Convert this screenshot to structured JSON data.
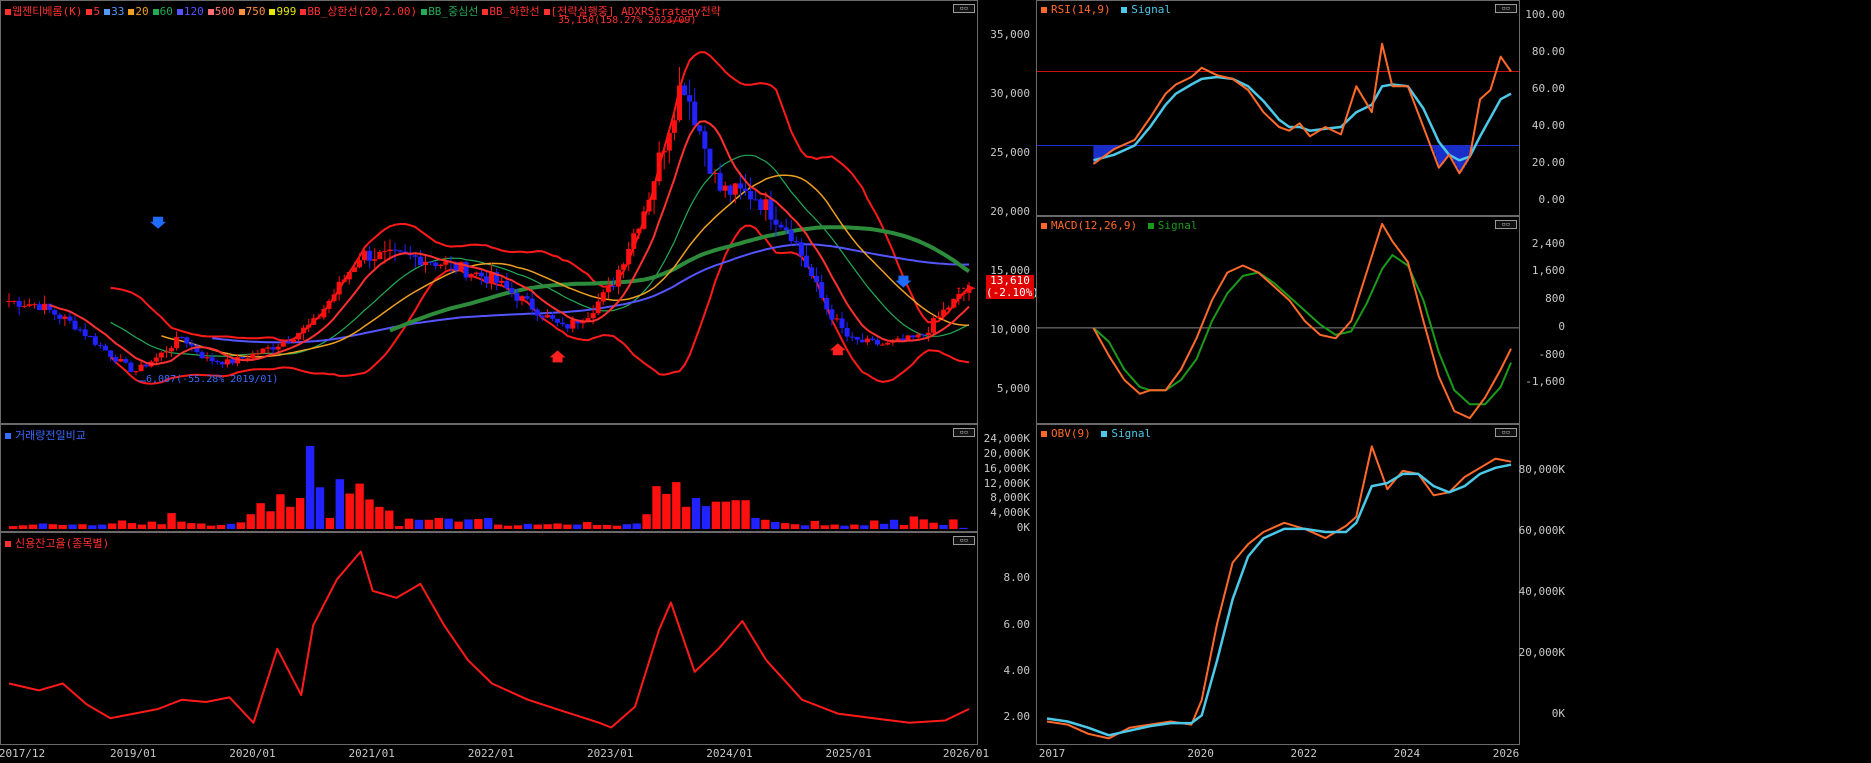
{
  "colors": {
    "up": "#ff1010",
    "down": "#2222ff",
    "bb": "#ff1a1a",
    "ma5": "#ff3030",
    "ma20": "#f0a020",
    "ma60": "#22aa55",
    "ma120": "#5555ff",
    "ma500": "#2d8c3c",
    "rsi": "#ff6a2a",
    "rsiSig": "#4cc8e8",
    "macd": "#ff6a2a",
    "macdSig": "#1a9a1a",
    "obv": "#ff6a2a",
    "obvSig": "#4cc8e8",
    "grid": "#555555"
  },
  "price_panel": {
    "legend": [
      {
        "text": "웹젠티베롬(K)",
        "color": "#ff3030"
      },
      {
        "text": "5",
        "color": "#ff3030"
      },
      {
        "text": "33",
        "color": "#5599ff"
      },
      {
        "text": "20",
        "color": "#f0a020"
      },
      {
        "text": "60",
        "color": "#22aa55"
      },
      {
        "text": "120",
        "color": "#5555ff"
      },
      {
        "text": "500",
        "color": "#ff7070"
      },
      {
        "text": "750",
        "color": "#ff9040"
      },
      {
        "text": "999",
        "color": "#e6e600"
      },
      {
        "text": "BB_상한선(20,2.00)",
        "color": "#ff3030"
      },
      {
        "text": "BB_중심선",
        "color": "#22aa55"
      },
      {
        "text": "BB_하한선",
        "color": "#ff3030"
      },
      {
        "text": "[전략실행중] ADXRStrategy전략",
        "color": "#ff3030"
      }
    ],
    "high_annotation": "35,150(158.27% 2023/09)",
    "low_annotation": "6,087(-55.28% 2019/01)",
    "current_price": "13,610",
    "current_change": "(-2.10%)"
  },
  "volume_panel": {
    "legend": "거래량전일비교",
    "legend_color": "#3a6aff"
  },
  "credit_panel": {
    "legend": "신용잔고율(종목별)",
    "legend_color": "#ff3030"
  },
  "rsi_panel": {
    "legend_a": "RSI(14,9)",
    "legend_b": "Signal"
  },
  "macd_panel": {
    "legend_a": "MACD(12,26,9)",
    "legend_b": "Signal"
  },
  "obv_panel": {
    "legend_a": "OBV(9)",
    "legend_b": "Signal"
  },
  "axes": {
    "price_ticks": [
      "35,000",
      "30,000",
      "25,000",
      "20,000",
      "15,000",
      "10,000",
      "5,000"
    ],
    "volume_ticks": [
      "24,000K",
      "20,000K",
      "16,000K",
      "12,000K",
      "8,000K",
      "4,000K",
      "0K"
    ],
    "credit_ticks": [
      "8.00",
      "6.00",
      "4.00",
      "2.00"
    ],
    "rsi_ticks": [
      "100.00",
      "80.00",
      "60.00",
      "40.00",
      "20.00",
      "0.00"
    ],
    "macd_ticks": [
      "2,400",
      "1,600",
      "800",
      "0",
      "-800",
      "-1,600"
    ],
    "obv_ticks": [
      "80,000K",
      "60,000K",
      "40,000K",
      "20,000K",
      "0K"
    ],
    "left_x_labels": [
      "2017/12",
      "2019/01",
      "2020/01",
      "2021/01",
      "2022/01",
      "2023/01",
      "2024/01",
      "2025/01",
      "2026/01"
    ],
    "right_x_labels": [
      "2017",
      "2020",
      "2022",
      "2024",
      "2026"
    ]
  },
  "chart_data": [
    {
      "type": "candlestick",
      "title": "웹젠티베롬(K)",
      "x_range": [
        "2017/12",
        "2026/01"
      ],
      "ylim": [
        2000,
        38000
      ],
      "close_trend": [
        [
          2017.9,
          12600
        ],
        [
          2018.2,
          12200
        ],
        [
          2018.5,
          10500
        ],
        [
          2018.8,
          8000
        ],
        [
          2019.0,
          6500
        ],
        [
          2019.2,
          7800
        ],
        [
          2019.4,
          9500
        ],
        [
          2019.6,
          7600
        ],
        [
          2019.8,
          7300
        ],
        [
          2020.0,
          8000
        ],
        [
          2020.2,
          8800
        ],
        [
          2020.5,
          10600
        ],
        [
          2020.7,
          13500
        ],
        [
          2020.9,
          16500
        ],
        [
          2021.1,
          16300
        ],
        [
          2021.4,
          16200
        ],
        [
          2021.7,
          15400
        ],
        [
          2022.0,
          14400
        ],
        [
          2022.3,
          12300
        ],
        [
          2022.6,
          10200
        ],
        [
          2022.8,
          11400
        ],
        [
          2023.0,
          13700
        ],
        [
          2023.3,
          21000
        ],
        [
          2023.6,
          31500
        ],
        [
          2023.9,
          22000
        ],
        [
          2024.2,
          21500
        ],
        [
          2024.5,
          18500
        ],
        [
          2024.8,
          12000
        ],
        [
          2025.0,
          9200
        ],
        [
          2025.3,
          8800
        ],
        [
          2025.6,
          9500
        ],
        [
          2025.8,
          11800
        ],
        [
          2026.0,
          13610
        ]
      ],
      "indicators": [
        "BB upper",
        "BB middle",
        "BB lower",
        "MA20",
        "MA60",
        "MA120",
        "MA500"
      ]
    },
    {
      "type": "bar",
      "title": "거래량전일비교",
      "ylim": [
        0,
        26000
      ],
      "unit": "K",
      "values": [
        800,
        1000,
        1200,
        1500,
        1300,
        1100,
        1200,
        1300,
        1000,
        1200,
        1500,
        2300,
        1600,
        1200,
        2000,
        1300,
        4300,
        2000,
        1600,
        1500,
        900,
        1100,
        1400,
        1800,
        4000,
        7000,
        4800,
        9400,
        6000,
        8400,
        22500,
        11300,
        3000,
        13500,
        9600,
        12300,
        8000,
        6000,
        5000,
        800,
        2800,
        2500,
        2500,
        3000,
        2800,
        2000,
        2600,
        2700,
        3000,
        1200,
        900,
        1000,
        1400,
        1200,
        1300,
        1500,
        1200,
        1200,
        1900,
        1100,
        1100,
        900,
        1300,
        1500,
        4000,
        11600,
        9500,
        12700,
        6000,
        8400,
        6200,
        7400,
        7400,
        7800,
        7800,
        3000,
        2500,
        1900,
        1600,
        1300,
        1000,
        2200,
        1000,
        1200,
        900,
        1200,
        1000,
        2300,
        1400,
        2500,
        1100,
        3400,
        2600,
        1700,
        1100,
        2600,
        300
      ]
    },
    {
      "type": "line",
      "title": "신용잔고율(종목별)",
      "ylim": [
        0.8,
        10
      ],
      "x": [
        2017.95,
        2018.2,
        2018.4,
        2018.6,
        2018.8,
        2019.0,
        2019.2,
        2019.4,
        2019.6,
        2019.8,
        2020.0,
        2020.2,
        2020.4,
        2020.5,
        2020.7,
        2020.9,
        2021.0,
        2021.2,
        2021.4,
        2021.6,
        2021.8,
        2022.0,
        2022.3,
        2022.6,
        2022.9,
        2023.0,
        2023.2,
        2023.4,
        2023.5,
        2023.7,
        2023.9,
        2024.1,
        2024.3,
        2024.6,
        2024.9,
        2025.2,
        2025.5,
        2025.8,
        2026.0
      ],
      "values": [
        3.5,
        3.2,
        3.5,
        2.6,
        2.0,
        2.2,
        2.4,
        2.8,
        2.7,
        2.9,
        1.8,
        5.0,
        3.0,
        6.0,
        8.0,
        9.2,
        7.5,
        7.2,
        7.8,
        6.0,
        4.5,
        3.5,
        2.8,
        2.3,
        1.8,
        1.6,
        2.5,
        5.8,
        7.0,
        4.0,
        5.0,
        6.2,
        4.5,
        2.8,
        2.2,
        2.0,
        1.8,
        1.9,
        2.4
      ]
    },
    {
      "type": "line",
      "title": "RSI(14,9)",
      "ylim": [
        0,
        100
      ],
      "reference_lines": [
        70,
        30
      ],
      "x": [
        2017.9,
        2018.3,
        2018.7,
        2019.0,
        2019.3,
        2019.5,
        2019.8,
        2020.0,
        2020.3,
        2020.6,
        2020.9,
        2021.2,
        2021.5,
        2021.7,
        2021.9,
        2022.1,
        2022.4,
        2022.7,
        2023.0,
        2023.3,
        2023.5,
        2023.7,
        2024.0,
        2024.3,
        2024.6,
        2024.8,
        2025.0,
        2025.2,
        2025.4,
        2025.6,
        2025.8,
        2026.0
      ],
      "series": [
        {
          "name": "RSI",
          "values": [
            20,
            28,
            33,
            45,
            58,
            63,
            67,
            72,
            68,
            66,
            60,
            48,
            40,
            38,
            42,
            35,
            40,
            36,
            62,
            48,
            85,
            62,
            62,
            40,
            18,
            25,
            15,
            24,
            55,
            60,
            78,
            70
          ]
        },
        {
          "name": "Signal",
          "values": [
            22,
            25,
            30,
            40,
            52,
            58,
            63,
            66,
            67,
            66,
            62,
            54,
            44,
            40,
            40,
            38,
            39,
            40,
            48,
            52,
            62,
            63,
            62,
            50,
            32,
            25,
            22,
            24,
            35,
            45,
            55,
            58
          ]
        }
      ]
    },
    {
      "type": "line",
      "title": "MACD(12,26,9)",
      "ylim": [
        -2800,
        3200
      ],
      "x": [
        2017.9,
        2018.2,
        2018.5,
        2018.8,
        2019.0,
        2019.3,
        2019.6,
        2019.9,
        2020.2,
        2020.5,
        2020.8,
        2021.1,
        2021.4,
        2021.7,
        2022.0,
        2022.3,
        2022.6,
        2022.9,
        2023.2,
        2023.5,
        2023.7,
        2024.0,
        2024.3,
        2024.6,
        2024.9,
        2025.2,
        2025.5,
        2025.8,
        2026.0
      ],
      "series": [
        {
          "name": "MACD",
          "values": [
            0,
            -800,
            -1500,
            -1900,
            -1800,
            -1800,
            -1200,
            -300,
            800,
            1600,
            1800,
            1600,
            1200,
            800,
            200,
            -200,
            -300,
            200,
            1600,
            3000,
            2500,
            1900,
            200,
            -1400,
            -2400,
            -2600,
            -2000,
            -1200,
            -600
          ]
        },
        {
          "name": "Signal",
          "values": [
            0,
            -400,
            -1200,
            -1700,
            -1800,
            -1800,
            -1500,
            -900,
            200,
            1000,
            1500,
            1600,
            1300,
            900,
            500,
            100,
            -200,
            -100,
            700,
            1700,
            2100,
            1800,
            800,
            -700,
            -1800,
            -2200,
            -2200,
            -1700,
            -1000
          ]
        }
      ]
    },
    {
      "type": "line",
      "title": "OBV(9)",
      "ylim": [
        -10000,
        95000
      ],
      "x": [
        2017.0,
        2017.4,
        2017.8,
        2018.2,
        2018.6,
        2019.0,
        2019.4,
        2019.8,
        2020.0,
        2020.3,
        2020.6,
        2020.9,
        2021.2,
        2021.6,
        2022.0,
        2022.4,
        2022.8,
        2023.0,
        2023.3,
        2023.6,
        2023.9,
        2024.2,
        2024.5,
        2024.8,
        2025.1,
        2025.4,
        2025.7,
        2026.0
      ],
      "series": [
        {
          "name": "OBV",
          "values": [
            -2000,
            -3000,
            -6000,
            -7500,
            -4000,
            -3000,
            -2000,
            -3000,
            5000,
            30000,
            50000,
            56000,
            60000,
            63000,
            61000,
            58000,
            62000,
            65000,
            88000,
            74000,
            80000,
            79000,
            72000,
            73000,
            78000,
            81000,
            84000,
            83000
          ]
        },
        {
          "name": "Signal",
          "values": [
            -1000,
            -2000,
            -4000,
            -6500,
            -5000,
            -3500,
            -2500,
            -2500,
            0,
            18000,
            38000,
            52000,
            58000,
            61000,
            61000,
            60000,
            60000,
            63000,
            75000,
            76000,
            79000,
            79000,
            75000,
            73000,
            75000,
            79000,
            81000,
            82000
          ]
        }
      ]
    }
  ]
}
